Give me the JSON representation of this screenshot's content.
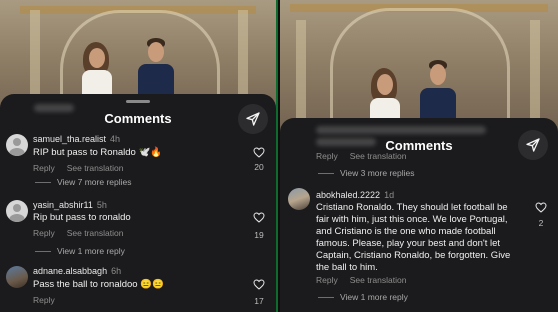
{
  "left": {
    "title": "Comments",
    "comments": [
      {
        "user": "samuel_tha.realist",
        "time": "4h",
        "text": "RIP but pass to Ronaldo 🕊️🔥",
        "reply": "Reply",
        "see_translation": "See translation",
        "likes": "20",
        "more_replies": "View 7 more replies"
      },
      {
        "user": "yasin_abshir11",
        "time": "5h",
        "text": "Rip but pass to ronaldo",
        "reply": "Reply",
        "see_translation": "See translation",
        "likes": "19",
        "more_replies": "View 1 more reply"
      },
      {
        "user": "adnane.alsabbagh",
        "time": "6h",
        "text": "Pass the ball to ronaldoo 😑😑",
        "reply": "Reply",
        "likes": "17"
      }
    ]
  },
  "right": {
    "title": "Comments",
    "prev_actions": {
      "reply": "Reply",
      "see_translation": "See translation"
    },
    "prev_more_replies": "View 3 more replies",
    "comment": {
      "user": "abokhaled.2222",
      "time": "1d",
      "text_lines": [
        "Cristiano Ronaldo. They should let football be",
        "fair with him, just this once. We love Portugal,",
        "and Cristiano is the one who made football",
        "famous. Please, play your best and don't let",
        "Captain, Cristiano Ronaldo, be forgotten. Give",
        "the ball to him."
      ],
      "reply": "Reply",
      "see_translation": "See translation",
      "likes": "2",
      "more_replies": "View 1 more reply"
    }
  },
  "colors": {
    "sheet": "#1b1b1d",
    "divider": "#0e6b2e"
  }
}
